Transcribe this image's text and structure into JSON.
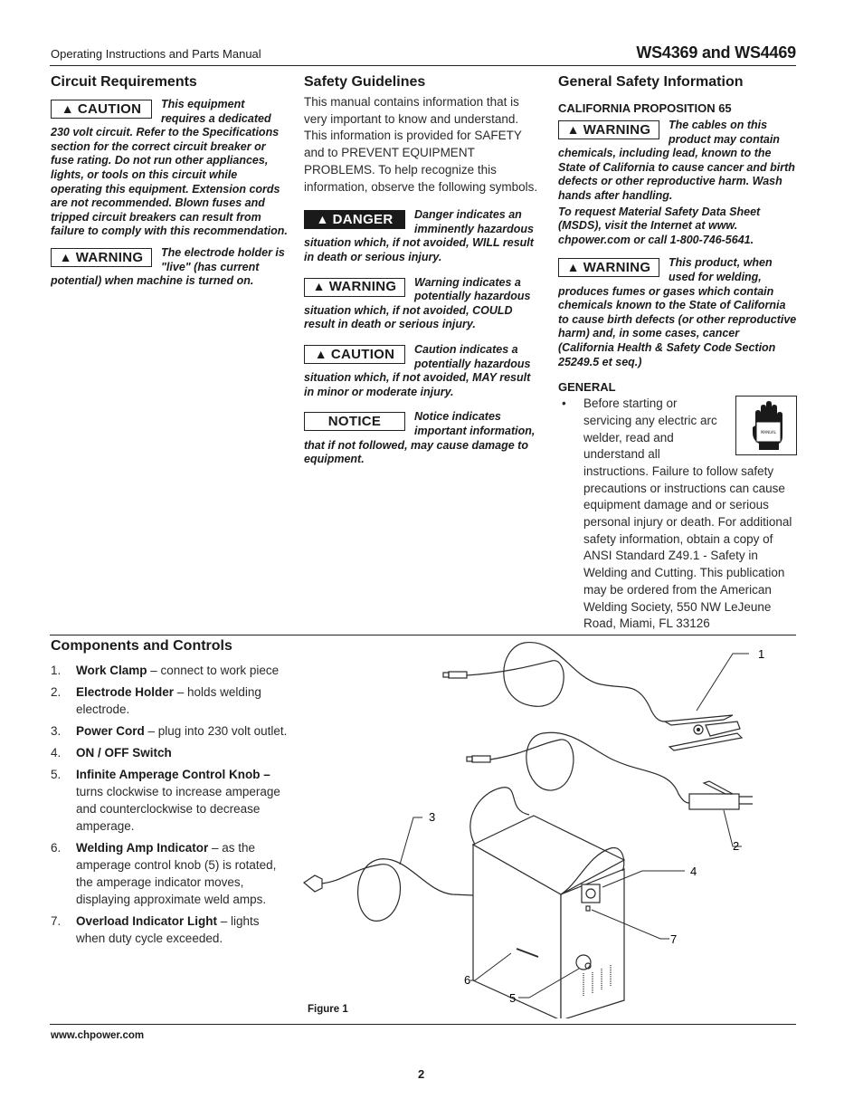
{
  "header": {
    "left": "Operating Instructions and Parts Manual",
    "right": "WS4369 and WS4469"
  },
  "circuit": {
    "title": "Circuit Requirements",
    "caution": {
      "label": "CAUTION",
      "text": "This equipment requires a dedicated 230 volt circuit. Refer to the Specifications section for the correct circuit breaker or fuse rating. Do not run other appliances, lights, or tools on this circuit while operating this equipment. Extension cords are not recommended. Blown fuses and tripped circuit breakers can result from failure to comply with this recommendation."
    },
    "warning": {
      "label": "WARNING",
      "text": "The electrode holder is \"live\" (has current potential) when machine is turned on."
    }
  },
  "safety_guidelines": {
    "title": "Safety Guidelines",
    "intro": "This manual contains information that is very important to know and understand. This information is provided for SAFETY and to PREVENT EQUIPMENT PROBLEMS. To help recognize this information, observe the following symbols.",
    "danger": {
      "label": "DANGER",
      "text": "Danger indicates an imminently hazardous situation which, if not avoided, WILL result in death or serious injury."
    },
    "warning": {
      "label": "WARNING",
      "text": "Warning indicates a potentially hazardous situation which, if not avoided, COULD result in death or serious injury."
    },
    "caution": {
      "label": "CAUTION",
      "text": "Caution indicates a potentially hazardous situation which, if not avoided, MAY result in minor or moderate injury."
    },
    "notice": {
      "label": "NOTICE",
      "text": "Notice indicates important information, that if not followed, may cause damage to equipment."
    }
  },
  "general_safety": {
    "title": "General Safety Information",
    "prop65_heading": "CALIFORNIA PROPOSITION 65",
    "warning1": {
      "label": "WARNING",
      "text": "The cables on this product may contain chemicals, including lead, known to the State of California to cause cancer and birth defects or other reproductive harm. Wash hands after handling."
    },
    "msds": "To request Material Safety Data Sheet (MSDS), visit the Internet at www. chpower.com or call 1-800-746-5641.",
    "warning2": {
      "label": "WARNING",
      "text": "This product, when used for welding, produces fumes or gases which contain chemicals known to the State of California to cause birth defects (or other reproductive harm) and, in some cases, cancer (California Health & Safety Code Section 25249.5 et seq.)"
    },
    "general_heading": "GENERAL",
    "manual_icon_label": "MANUAL",
    "general_bullet": "Before starting or servicing any electric arc welder, read and understand all instructions. Failure to follow safety precautions or instructions can cause equipment damage and or serious personal injury or death. For additional safety information, obtain a copy of ANSI Standard Z49.1 - Safety in Welding and Cutting. This publication may be ordered from the American Welding Society, 550 NW LeJeune Road, Miami, FL 33126"
  },
  "components": {
    "title": "Components and Controls",
    "items": [
      {
        "num": "1.",
        "name": "Work Clamp",
        "desc": " – connect to work piece"
      },
      {
        "num": "2.",
        "name": "Electrode Holder",
        "desc": " – holds welding electrode."
      },
      {
        "num": "3.",
        "name": "Power Cord",
        "desc": " – plug into 230 volt outlet."
      },
      {
        "num": "4.",
        "name": "ON / OFF Switch",
        "desc": ""
      },
      {
        "num": "5.",
        "name": "Infinite Amperage Control Knob –",
        "desc": " turns clockwise to increase amperage and counterclockwise to decrease amperage."
      },
      {
        "num": "6.",
        "name": "Welding Amp Indicator",
        "desc": " – as the amperage control knob (5) is rotated, the amperage indicator moves, displaying approximate weld amps."
      },
      {
        "num": "7.",
        "name": "Overload Indicator Light",
        "desc": " – lights when duty cycle exceeded."
      }
    ]
  },
  "figure": {
    "caption": "Figure 1",
    "callouts": [
      "1",
      "2",
      "3",
      "4",
      "5",
      "6",
      "7"
    ]
  },
  "footer": {
    "url": "www.chpower.com",
    "page": "2"
  }
}
